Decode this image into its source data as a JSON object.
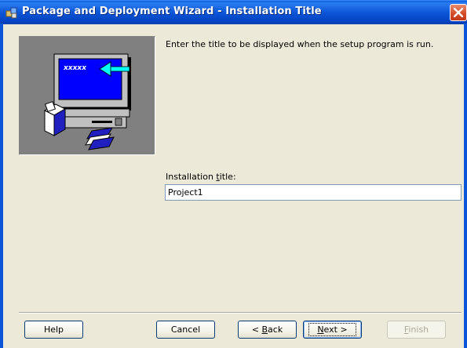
{
  "window": {
    "title": "Package and Deployment Wizard - Installation Title",
    "icon": "package-wizard-icon",
    "close_icon": "close-icon"
  },
  "main": {
    "picture_label": "xxxxx",
    "instruction": "Enter the title to be displayed when the setup program is run.",
    "field_label_pre": "Installation ",
    "field_label_accel": "t",
    "field_label_post": "itle:",
    "title_value": "Project1"
  },
  "buttons": {
    "help": "Help",
    "cancel": "Cancel",
    "back_accel": "B",
    "back_pre": "< ",
    "back_post": "ack",
    "next_accel": "N",
    "next_post": "ext >",
    "finish_accel": "F",
    "finish_post": "inish",
    "finish_enabled": false
  },
  "colors": {
    "titlebar": "#0b56d8",
    "close": "#d24a26",
    "dialog_bg": "#ece9d8",
    "picture_bg": "#808080",
    "monitor_screen": "#0000ff",
    "arrow": "#00ffff"
  }
}
